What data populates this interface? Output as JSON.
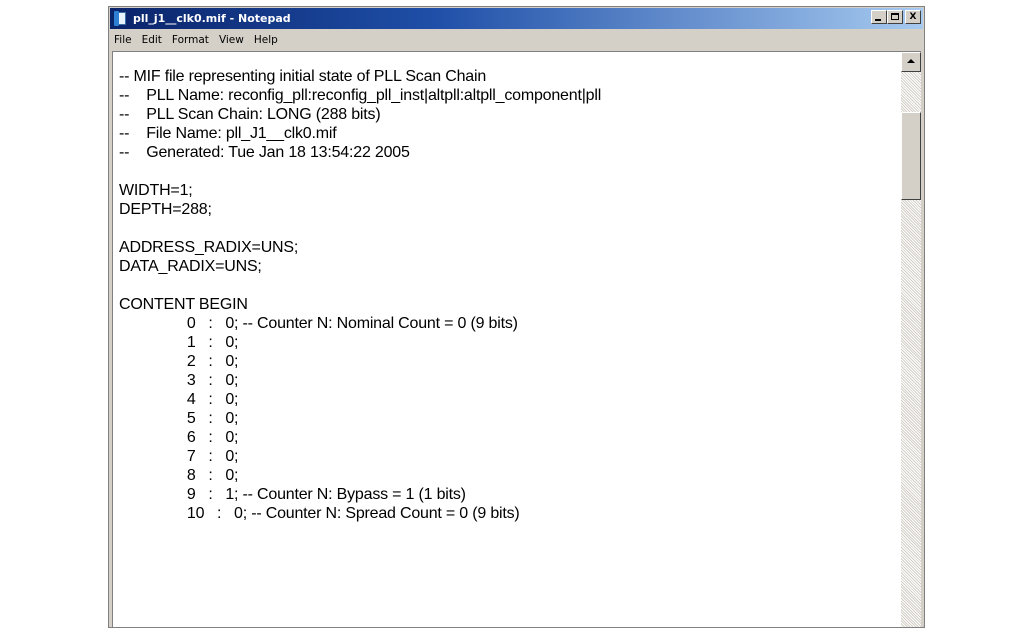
{
  "window": {
    "title": "pll_j1__clk0.mif - Notepad",
    "buttons": {
      "minimize": "_",
      "maximize": "□",
      "close": "X"
    }
  },
  "menu": {
    "items": [
      "File",
      "Edit",
      "Format",
      "View",
      "Help"
    ]
  },
  "document": {
    "lines": [
      "-- MIF file representing initial state of PLL Scan Chain",
      "--    PLL Name: reconfig_pll:reconfig_pll_inst|altpll:altpll_component|pll",
      "--    PLL Scan Chain: LONG (288 bits)",
      "--    File Name: pll_J1__clk0.mif",
      "--    Generated: Tue Jan 18 13:54:22 2005",
      "",
      "WIDTH=1;",
      "DEPTH=288;",
      "",
      "ADDRESS_RADIX=UNS;",
      "DATA_RADIX=UNS;",
      "",
      "CONTENT BEGIN",
      "                0   :   0; -- Counter N: Nominal Count = 0 (9 bits)",
      "                1   :   0;",
      "                2   :   0;",
      "                3   :   0;",
      "                4   :   0;",
      "                5   :   0;",
      "                6   :   0;",
      "                7   :   0;",
      "                8   :   0;",
      "                9   :   1; -- Counter N: Bypass = 1 (1 bits)",
      "                10   :   0; -- Counter N: Spread Count = 0 (9 bits)"
    ]
  },
  "scrollbar": {
    "position": 0.0
  }
}
